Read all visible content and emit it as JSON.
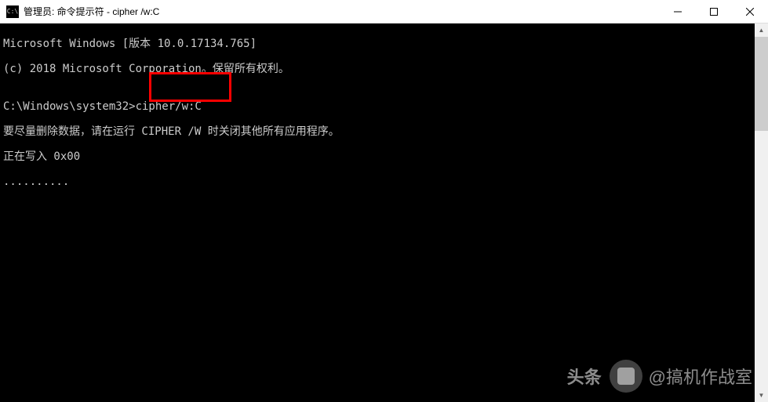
{
  "window": {
    "title": "管理员: 命令提示符 - cipher /w:C",
    "icon_text": "C:\\"
  },
  "terminal": {
    "line1": "Microsoft Windows [版本 10.0.17134.765]",
    "line2": "(c) 2018 Microsoft Corporation。保留所有权利。",
    "line3": "",
    "prompt": "C:\\Windows\\system32>",
    "command": "cipher/w:C",
    "line5": "要尽量删除数据，请在运行 CIPHER /W 时关闭其他所有应用程序。",
    "line6": "正在写入 0x00",
    "line7": ".........."
  },
  "watermark": {
    "left": "头条",
    "right": "@搞机作战室"
  },
  "scrollbar": {
    "up": "▲",
    "down": "▼"
  }
}
